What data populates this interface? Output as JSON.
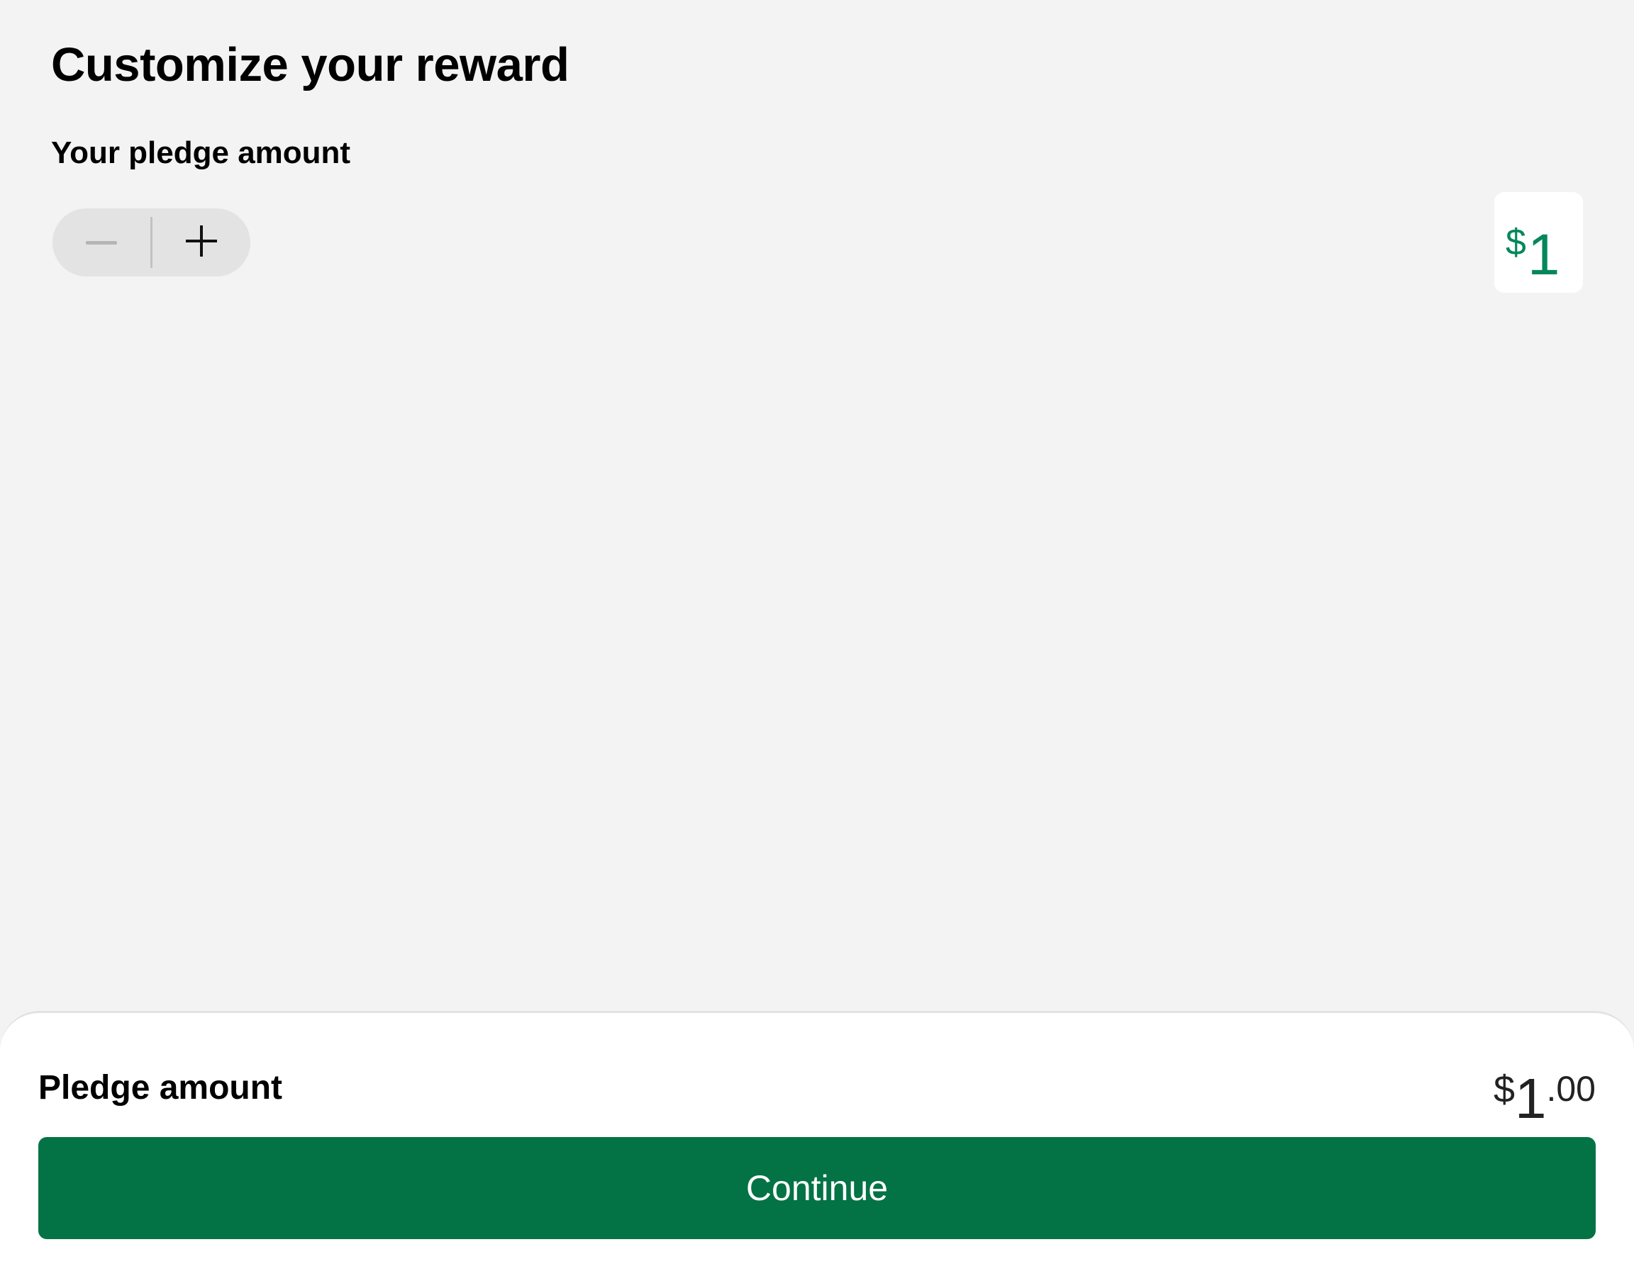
{
  "header": {
    "title": "Customize your reward"
  },
  "pledge": {
    "label": "Your pledge amount",
    "currency_symbol": "$",
    "value": "1",
    "decrement_icon": "minus-icon",
    "increment_icon": "plus-icon"
  },
  "footer": {
    "label": "Pledge amount",
    "currency_symbol": "$",
    "amount_whole": "1",
    "amount_decimal": ".00",
    "continue_label": "Continue"
  },
  "colors": {
    "accent_green": "#037245",
    "amount_green": "#05875a",
    "background": "#f3f3f3",
    "stepper_bg": "#e3e3e3"
  }
}
